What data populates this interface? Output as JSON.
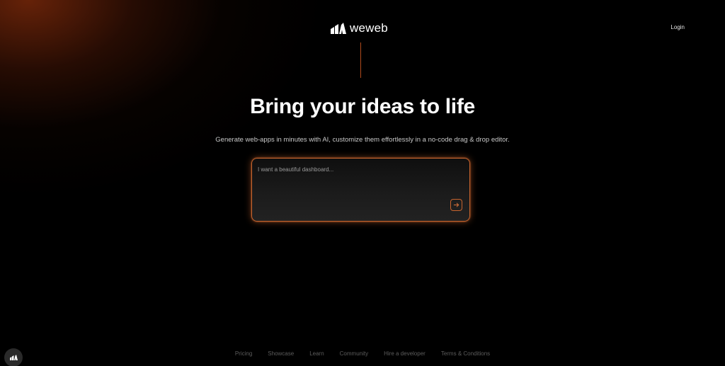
{
  "brand": {
    "name": "weweb",
    "logo_icon": "weweb-logo-icon"
  },
  "header": {
    "login_label": "Login"
  },
  "hero": {
    "title": "Bring your ideas to life",
    "subtitle": "Generate web-apps in minutes with AI, customize them effortlessly in a no-code drag & drop editor."
  },
  "prompt": {
    "placeholder": "I want a beautiful dashboard...",
    "value": "",
    "submit_icon": "arrow-right-icon"
  },
  "footer": {
    "links": [
      {
        "label": "Pricing"
      },
      {
        "label": "Showcase"
      },
      {
        "label": "Learn"
      },
      {
        "label": "Community"
      },
      {
        "label": "Hire a developer"
      },
      {
        "label": "Terms & Conditions"
      }
    ]
  },
  "colors": {
    "background": "#000000",
    "accent": "#c7642e",
    "glow": "#78280a"
  }
}
